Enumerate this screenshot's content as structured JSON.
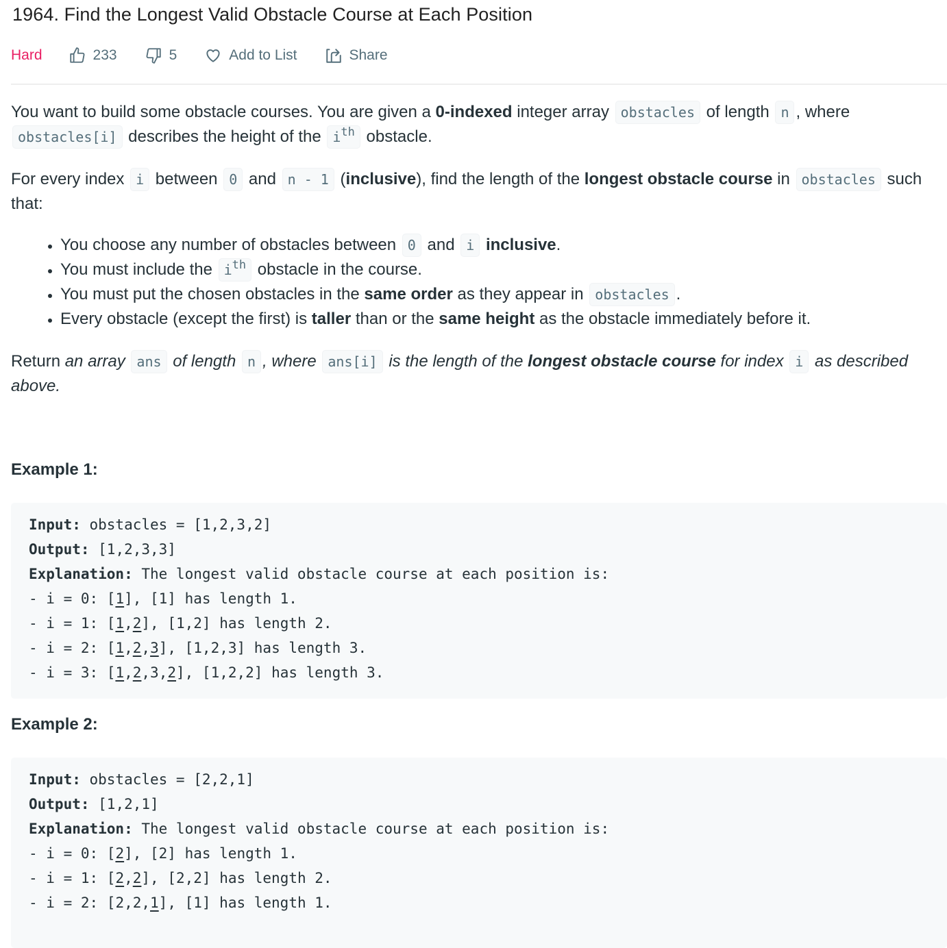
{
  "problem": {
    "title": "1964. Find the Longest Valid Obstacle Course at Each Position",
    "difficulty": "Hard",
    "likes": "233",
    "dislikes": "5",
    "add_to_list_label": "Add to List",
    "share_label": "Share",
    "colors": {
      "difficulty": "#e91e63",
      "meta": "#546e7a",
      "code_bg": "#f7f9fa"
    }
  },
  "description": {
    "p1": {
      "t1": "You want to build some obstacle courses. You are given a ",
      "b1": "0-indexed",
      "t2": " integer array ",
      "c1": "obstacles",
      "t3": " of length ",
      "c2": "n",
      "t4": ", where ",
      "c3": "obstacles[i]",
      "t5": " describes the height of the ",
      "c4_base": "i",
      "c4_sup": "th",
      "t6": " obstacle."
    },
    "p2": {
      "t1": "For every index ",
      "c1": "i",
      "t2": " between ",
      "c2": "0",
      "t3": " and ",
      "c3": "n - 1",
      "t4": " (",
      "b1": "inclusive",
      "t5": "), find the length of the ",
      "b2": "longest obstacle course",
      "t6": " in ",
      "c4": "obstacles",
      "t7": " such that:"
    },
    "bullets": [
      {
        "t1": "You choose any number of obstacles between ",
        "c1": "0",
        "t2": " and ",
        "c2": "i",
        "t3": " ",
        "b1": "inclusive",
        "t4": "."
      },
      {
        "t1": "You must include the ",
        "c1_base": "i",
        "c1_sup": "th",
        "t2": " obstacle in the course."
      },
      {
        "t1": "You must put the chosen obstacles in the ",
        "b1": "same order",
        "t2": " as they appear in ",
        "c1": "obstacles",
        "t3": "."
      },
      {
        "t1": "Every obstacle (except the first) is ",
        "b1": "taller",
        "t2": " than or the ",
        "b2": "same height",
        "t3": " as the obstacle immediately before it."
      }
    ],
    "ret": {
      "t1": "Return ",
      "e1": "an array",
      "c1": "ans",
      "e2": "of length",
      "c2": "n",
      "e3": ", where",
      "c3": "ans[i]",
      "e4": "is the length of the ",
      "b1": "longest obstacle course",
      "e5": " for index",
      "c4": "i",
      "e6": "as described above."
    }
  },
  "examples": [
    {
      "title": "Example 1:",
      "input_label": "Input:",
      "input_value": " obstacles = [1,2,3,2]",
      "output_label": "Output:",
      "output_value": " [1,2,3,3]",
      "explanation_label": "Explanation:",
      "explanation_value": " The longest valid obstacle course at each position is:",
      "lines": [
        {
          "prefix": "- i = 0: [",
          "parts": [
            {
              "u": "1"
            }
          ],
          "suffix": "], [1] has length 1."
        },
        {
          "prefix": "- i = 1: [",
          "parts": [
            {
              "u": "1"
            },
            {
              "t": ","
            },
            {
              "u": "2"
            }
          ],
          "suffix": "], [1,2] has length 2."
        },
        {
          "prefix": "- i = 2: [",
          "parts": [
            {
              "u": "1"
            },
            {
              "t": ","
            },
            {
              "u": "2"
            },
            {
              "t": ","
            },
            {
              "u": "3"
            }
          ],
          "suffix": "], [1,2,3] has length 3."
        },
        {
          "prefix": "- i = 3: [",
          "parts": [
            {
              "u": "1"
            },
            {
              "t": ","
            },
            {
              "u": "2"
            },
            {
              "t": ",3,"
            },
            {
              "u": "2"
            }
          ],
          "suffix": "], [1,2,2] has length 3."
        }
      ]
    },
    {
      "title": "Example 2:",
      "input_label": "Input:",
      "input_value": " obstacles = [2,2,1]",
      "output_label": "Output:",
      "output_value": " [1,2,1]",
      "explanation_label": "Explanation:",
      "explanation_value": " The longest valid obstacle course at each position is:",
      "lines": [
        {
          "prefix": "- i = 0: [",
          "parts": [
            {
              "u": "2"
            }
          ],
          "suffix": "], [2] has length 1."
        },
        {
          "prefix": "- i = 1: [",
          "parts": [
            {
              "u": "2"
            },
            {
              "t": ","
            },
            {
              "u": "2"
            }
          ],
          "suffix": "], [2,2] has length 2."
        },
        {
          "prefix": "- i = 2: [",
          "parts": [
            {
              "t": "2,2,"
            },
            {
              "u": "1"
            }
          ],
          "suffix": "], [1] has length 1."
        }
      ]
    }
  ]
}
